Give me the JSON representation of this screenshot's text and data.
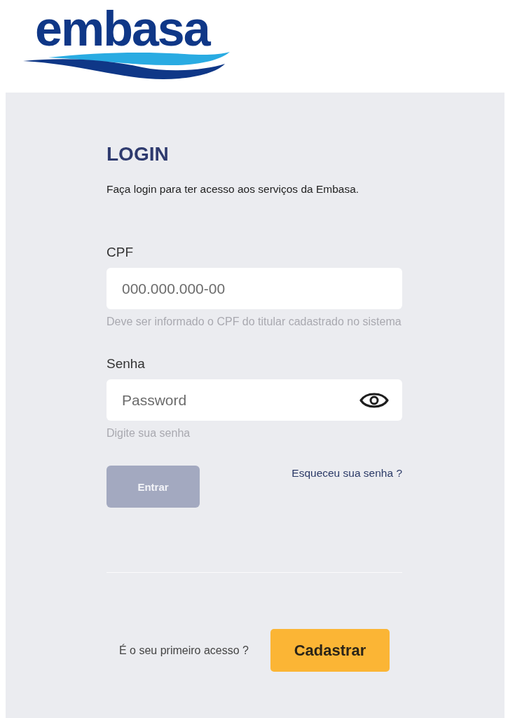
{
  "header": {
    "logo": "embasa"
  },
  "login": {
    "title": "LOGIN",
    "subtitle": "Faça login para ter acesso aos serviços da Embasa.",
    "fields": [
      {
        "kind": "text",
        "label": "CPF",
        "placeholder": "000.000.000-00",
        "hint": "Deve ser informado o CPF do titular cadastrado no sistema"
      },
      {
        "kind": "password",
        "label": "Senha",
        "placeholder": "Password",
        "hint": "Digite sua senha"
      }
    ],
    "submit": {
      "label": "Entrar",
      "disabled": true
    },
    "forgot_link": "Esqueceu sua senha ?"
  },
  "signup": {
    "prompt": "É o seu primeiro acesso ?",
    "button": "Cadastrar"
  }
}
